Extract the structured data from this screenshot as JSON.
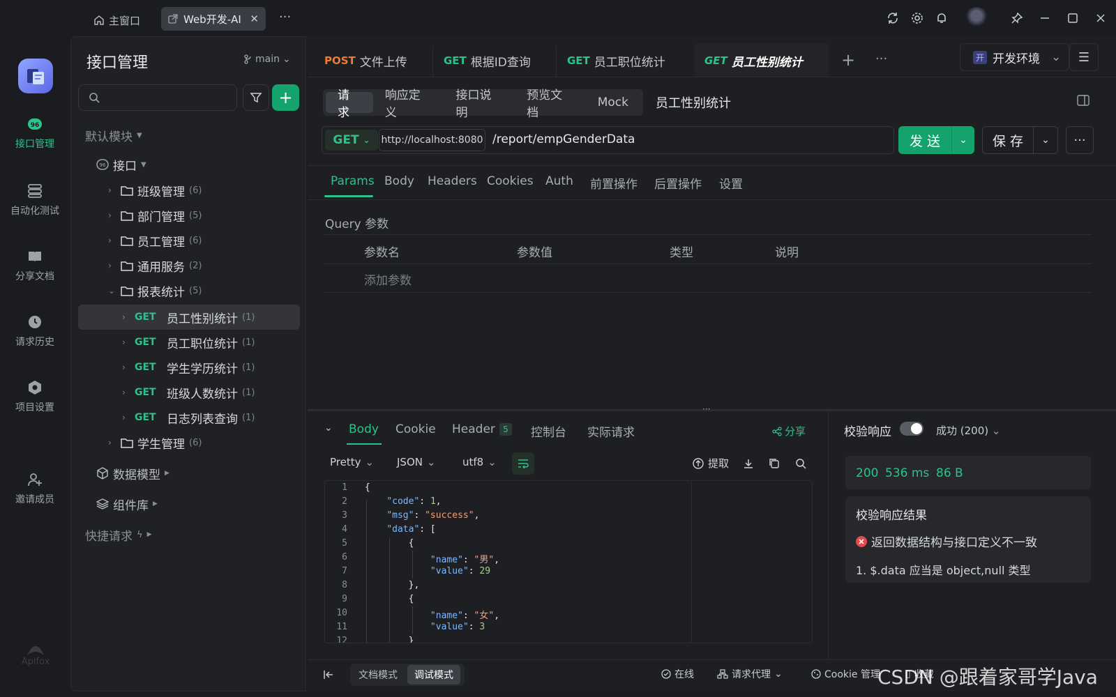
{
  "titlebar": {
    "home_tab": "主窗口",
    "active_tab": "Web开发-AI",
    "more": "···"
  },
  "rail": {
    "items": [
      {
        "label": "接口管理",
        "icon": "api-management-icon"
      },
      {
        "label": "自动化测试",
        "icon": "automation-test-icon"
      },
      {
        "label": "分享文档",
        "icon": "share-docs-icon"
      },
      {
        "label": "请求历史",
        "icon": "history-clock-icon"
      },
      {
        "label": "项目设置",
        "icon": "project-settings-icon"
      },
      {
        "label": "邀请成员",
        "icon": "invite-member-icon"
      }
    ],
    "bottom_logo": "Apifox"
  },
  "sidebar": {
    "title": "接口管理",
    "branch": "main",
    "default_module": "默认模块",
    "api_root": "接口",
    "folders": [
      {
        "name": "班级管理",
        "count": "(6)"
      },
      {
        "name": "部门管理",
        "count": "(5)"
      },
      {
        "name": "员工管理",
        "count": "(6)"
      },
      {
        "name": "通用服务",
        "count": "(2)"
      },
      {
        "name": "报表统计",
        "count": "(5)"
      }
    ],
    "report_items": [
      {
        "method": "GET",
        "name": "员工性别统计",
        "count": "(1)"
      },
      {
        "method": "GET",
        "name": "员工职位统计",
        "count": "(1)"
      },
      {
        "method": "GET",
        "name": "学生学历统计",
        "count": "(1)"
      },
      {
        "method": "GET",
        "name": "班级人数统计",
        "count": "(1)"
      },
      {
        "method": "GET",
        "name": "日志列表查询",
        "count": "(1)"
      }
    ],
    "student_folder": {
      "name": "学生管理",
      "count": "(6)"
    },
    "data_model": "数据模型",
    "component_lib": "组件库",
    "quick_request": "快捷请求"
  },
  "doc_tabs": [
    {
      "method": "POST",
      "name": "文件上传"
    },
    {
      "method": "GET",
      "name": "根据ID查询"
    },
    {
      "method": "GET",
      "name": "员工职位统计"
    },
    {
      "method": "GET",
      "name": "员工性别统计"
    }
  ],
  "environment": {
    "tag": "开",
    "name": "开发环境"
  },
  "request": {
    "segments": [
      "请求",
      "响应定义",
      "接口说明",
      "预览文档",
      "Mock"
    ],
    "name": "员工性别统计",
    "method": "GET",
    "host": "http://localhost:8080",
    "path": "/report/empGenderData",
    "send": "发 送",
    "save": "保 存"
  },
  "param_tabs": [
    "Params",
    "Body",
    "Headers",
    "Cookies",
    "Auth",
    "前置操作",
    "后置操作",
    "设置"
  ],
  "query": {
    "title": "Query 参数",
    "columns": [
      "参数名",
      "参数值",
      "类型",
      "说明"
    ],
    "add_placeholder": "添加参数"
  },
  "response": {
    "tabs": [
      "Body",
      "Cookie",
      "Header",
      "控制台",
      "实际请求"
    ],
    "header_count": "5",
    "share": "分享",
    "format": "Pretty",
    "type": "JSON",
    "encoding": "utf8",
    "extract": "提取",
    "line_numbers": [
      "1",
      "2",
      "3",
      "4",
      "5",
      "6",
      "7",
      "8",
      "9",
      "10",
      "11",
      "12"
    ],
    "code": {
      "l1": "{",
      "code_key": "\"code\"",
      "code_val": "1",
      "msg_key": "\"msg\"",
      "msg_val": "\"success\"",
      "data_key": "\"data\"",
      "name_key": "\"name\"",
      "value_key": "\"value\"",
      "name1": "\"男\"",
      "value1": "29",
      "name2": "\"女\"",
      "value2": "3"
    }
  },
  "validation": {
    "title": "校验响应",
    "status_select": "成功 (200)",
    "status": "200",
    "time": "536 ms",
    "size": "86 B",
    "result_title": "校验响应结果",
    "error": "返回数据结构与接口定义不一致",
    "detail": "1. $.data 应当是 object,null 类型"
  },
  "bottom": {
    "doc_mode": "文档模式",
    "debug_mode": "调试模式",
    "online": "在线",
    "proxy": "请求代理",
    "cookie": "Cookie 管理",
    "collect": "收藏",
    "watermark": "CSDN @跟着家哥学Java"
  },
  "colors": {
    "accent": "#2ec28b",
    "post": "#f07a33",
    "send_bg": "#14a36c",
    "error": "#e5484d"
  }
}
